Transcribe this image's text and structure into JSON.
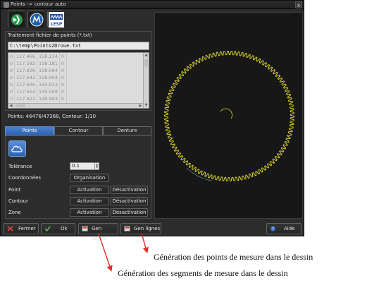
{
  "window": {
    "title": "Points -> contour auto",
    "close_label": "x"
  },
  "toolbar": {
    "icons": [
      "freecad-logo-icon",
      "compass-logo-icon",
      "lesp-logo-icon"
    ],
    "lesp_text": "LESP"
  },
  "file_group": {
    "title": "Traitement fichier de points (*.txt)",
    "path": "C:\\temp\\Points2Droue.txt"
  },
  "points_grid": {
    "rows": [
      [
        "0",
        "117.466",
        "158.114",
        "0"
      ],
      [
        "0",
        "117.582",
        "158.181",
        "0"
      ],
      [
        "0",
        "117.609",
        "158.064",
        "0"
      ],
      [
        "0",
        "117.642",
        "158.004",
        "0"
      ],
      [
        "0",
        "117.636",
        "150.913",
        "0"
      ],
      [
        "0",
        "117.614",
        "149.599",
        "0"
      ],
      [
        "0",
        "117.621",
        "149.993",
        "0"
      ]
    ],
    "scroll_up": "▲",
    "scroll_down": "▼",
    "scroll_left": "◀",
    "scroll_right": "▶"
  },
  "status_line": "Points: 46476/47368, Contour: 1/10",
  "tabs": [
    {
      "label": "Points",
      "active": true
    },
    {
      "label": "Contour",
      "active": false
    },
    {
      "label": "Denture",
      "active": false
    }
  ],
  "points_panel": {
    "tolerance_label": "Tolérance",
    "tolerance_value": "0.1",
    "spin_up": "▲",
    "spin_down": "▼",
    "coordinates_label": "Coordonnées",
    "organisation_label": "Organisation",
    "point_label": "Point",
    "contour_label": "Contour",
    "zone_label": "Zone",
    "activation_label": "Activation",
    "deactivation_label": "Désactivation"
  },
  "bottom_bar": {
    "close_label": "Fermer",
    "ok_label": "Ok",
    "gen_points_label": "Gen points",
    "gen_lines_label": "Gen lignes",
    "help_label": "Aide"
  },
  "annotations": {
    "points_caption": "Génération des points de mesure dans le dessin",
    "segments_caption": "Génération des segments de mesure dans le dessin"
  },
  "colors": {
    "window_bg": "#2c2c2c",
    "accent_blue": "#3b72c2",
    "gear_outline": "#d9d12a",
    "arrow_red": "#e0302a"
  }
}
